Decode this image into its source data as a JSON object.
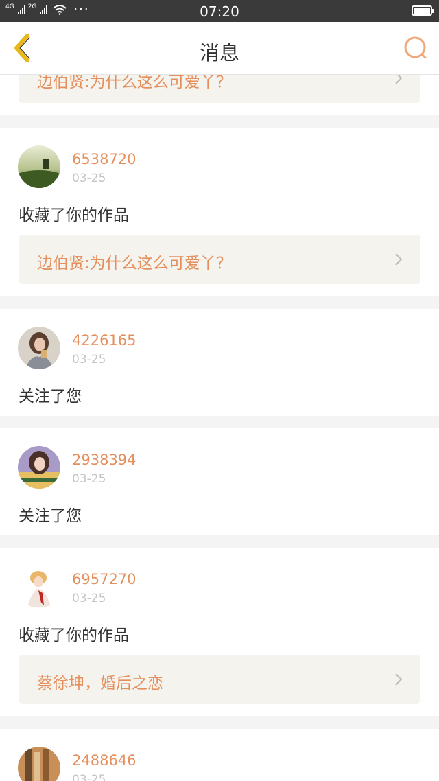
{
  "status_bar": {
    "net1": "4G",
    "net2": "2G",
    "time": "07:20",
    "icons": [
      "signal-icon",
      "wifi-icon",
      "more-dots-icon",
      "battery-icon"
    ]
  },
  "header": {
    "title": "消息",
    "back_icon": "chevron-left-icon",
    "search_icon": "search-icon",
    "accent": "#e6b81e",
    "search_color": "#f0a878"
  },
  "colors": {
    "username": "#e58f5d",
    "date": "#c4c4c4",
    "work_bg": "#f4f3ee",
    "divider": "#f4f4f4"
  },
  "messages": [
    {
      "work_title": "边伯贤:为什么这么可爱丫？"
    },
    {
      "user_id": "6538720",
      "date": "03-25",
      "action": "收藏了你的作品",
      "work_title": "边伯贤:为什么这么可爱丫？"
    },
    {
      "user_id": "4226165",
      "date": "03-25",
      "action": "关注了您"
    },
    {
      "user_id": "2938394",
      "date": "03-25",
      "action": "关注了您"
    },
    {
      "user_id": "6957270",
      "date": "03-25",
      "action": "收藏了你的作品",
      "work_title": "蔡徐坤，婚后之恋"
    },
    {
      "user_id": "2488646",
      "date": "03-25"
    }
  ]
}
